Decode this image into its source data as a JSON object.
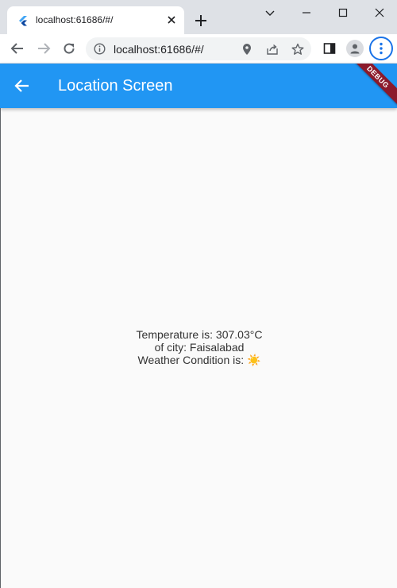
{
  "browser": {
    "tab": {
      "title": "localhost:61686/#/"
    },
    "address_bar": {
      "url": "localhost:61686/#/"
    }
  },
  "app": {
    "appbar": {
      "title": "Location Screen",
      "debug_label": "DEBUG"
    },
    "weather": {
      "temperature_text": "Temperature is: 307.03°C",
      "city_text": "of city: Faisalabad",
      "condition_text": "Weather Condition is: ☀️"
    }
  },
  "colors": {
    "appbar": "#2196f3",
    "background": "#fafafa",
    "debug_banner": "#8b1a2b"
  }
}
